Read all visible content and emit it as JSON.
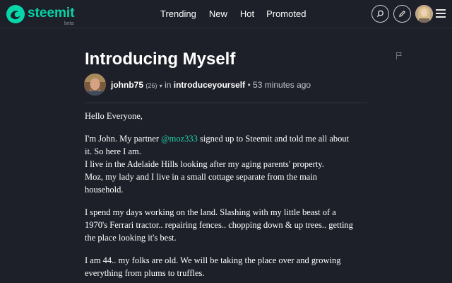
{
  "header": {
    "logo_text": "steemit",
    "logo_badge": "beta",
    "nav": [
      "Trending",
      "New",
      "Hot",
      "Promoted"
    ],
    "icons": {
      "search": "search-icon",
      "edit": "pencil-icon",
      "menu": "hamburger-icon"
    }
  },
  "post": {
    "title": "Introducing Myself",
    "author": "johnb75",
    "reputation": "(26)",
    "in_label": "in",
    "category": "introduceyourself",
    "separator": "•",
    "time": "53 minutes ago",
    "body": {
      "greeting": "Hello Everyone,",
      "p2_l1_a": "I'm John. My partner ",
      "p2_mention": "@moz333",
      "p2_l1_b": " signed up to Steemit and told me all about",
      "p2_l2": "it. So here I am.",
      "p2_l3": "I live in the Adelaide Hills looking after my aging parents' property.",
      "p2_l4": "Moz, my lady and I live in a small cottage separate from the main",
      "p2_l5": "household.",
      "p3_l1": "I spend my days working on the land. Slashing with my little beast of a",
      "p3_l2": "1970's Ferrari tractor.. repairing fences.. chopping down & up trees.. getting",
      "p3_l3": "the place looking it's best.",
      "p4_l1": "I am 44.. my folks are old. We will be taking the place over and growing",
      "p4_l2": "everything from plums to truffles."
    }
  },
  "colors": {
    "background": "#1d2029",
    "brand": "#06d6a9",
    "mention": "#1fcfa8"
  }
}
